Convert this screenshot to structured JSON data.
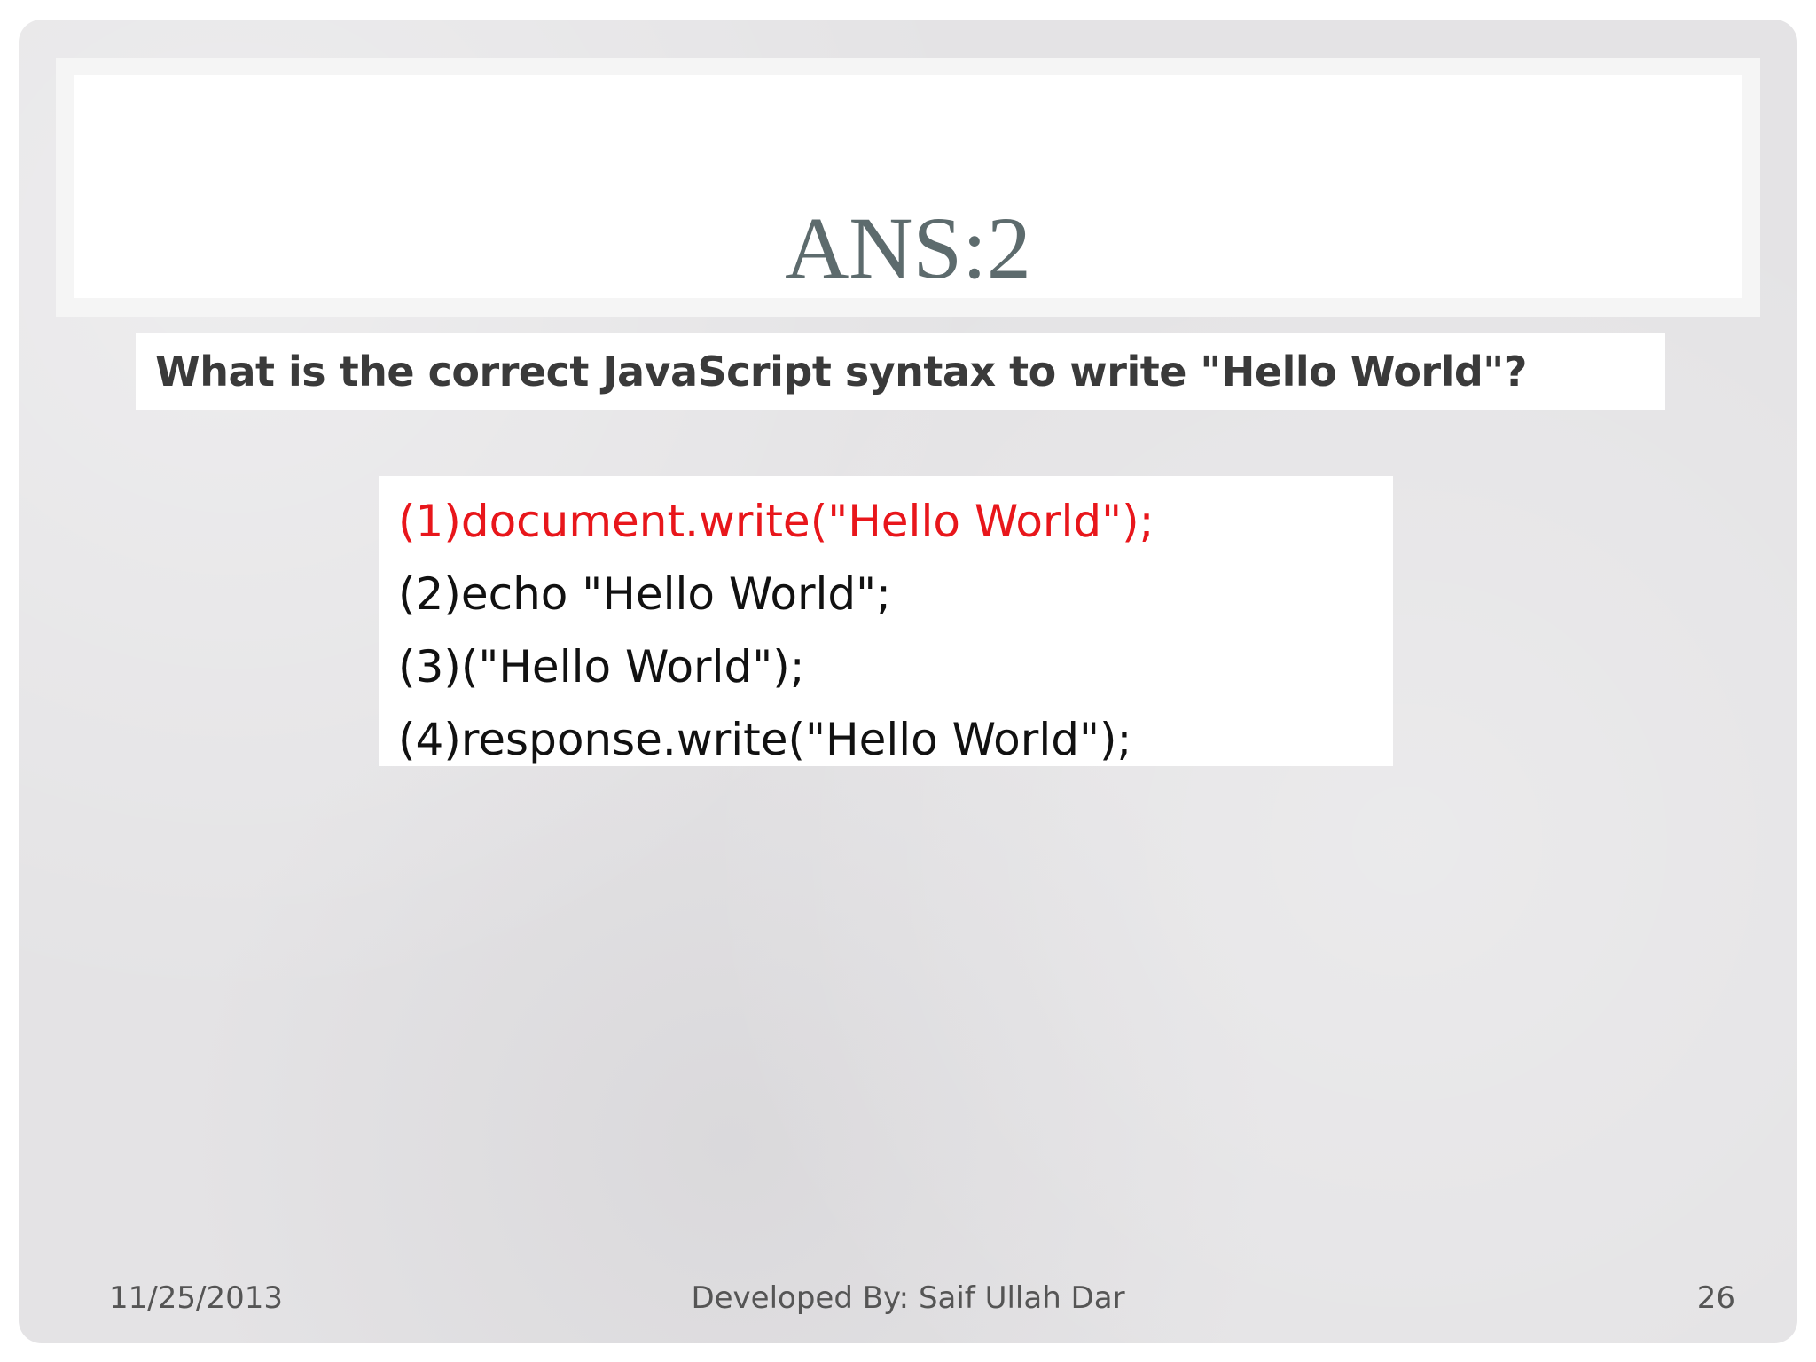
{
  "slide": {
    "title": "ANS:2",
    "question": "What is the correct JavaScript syntax to write \"Hello World\"?",
    "options": [
      "(1)document.write(\"Hello World\");",
      "(2)echo \"Hello World\";",
      "(3)(\"Hello World\");",
      "(4)response.write(\"Hello World\");"
    ],
    "correct_option_color": "#e8161b"
  },
  "footer": {
    "date": "11/25/2013",
    "author": "Developed By: Saif Ullah Dar",
    "page_number": "26"
  }
}
